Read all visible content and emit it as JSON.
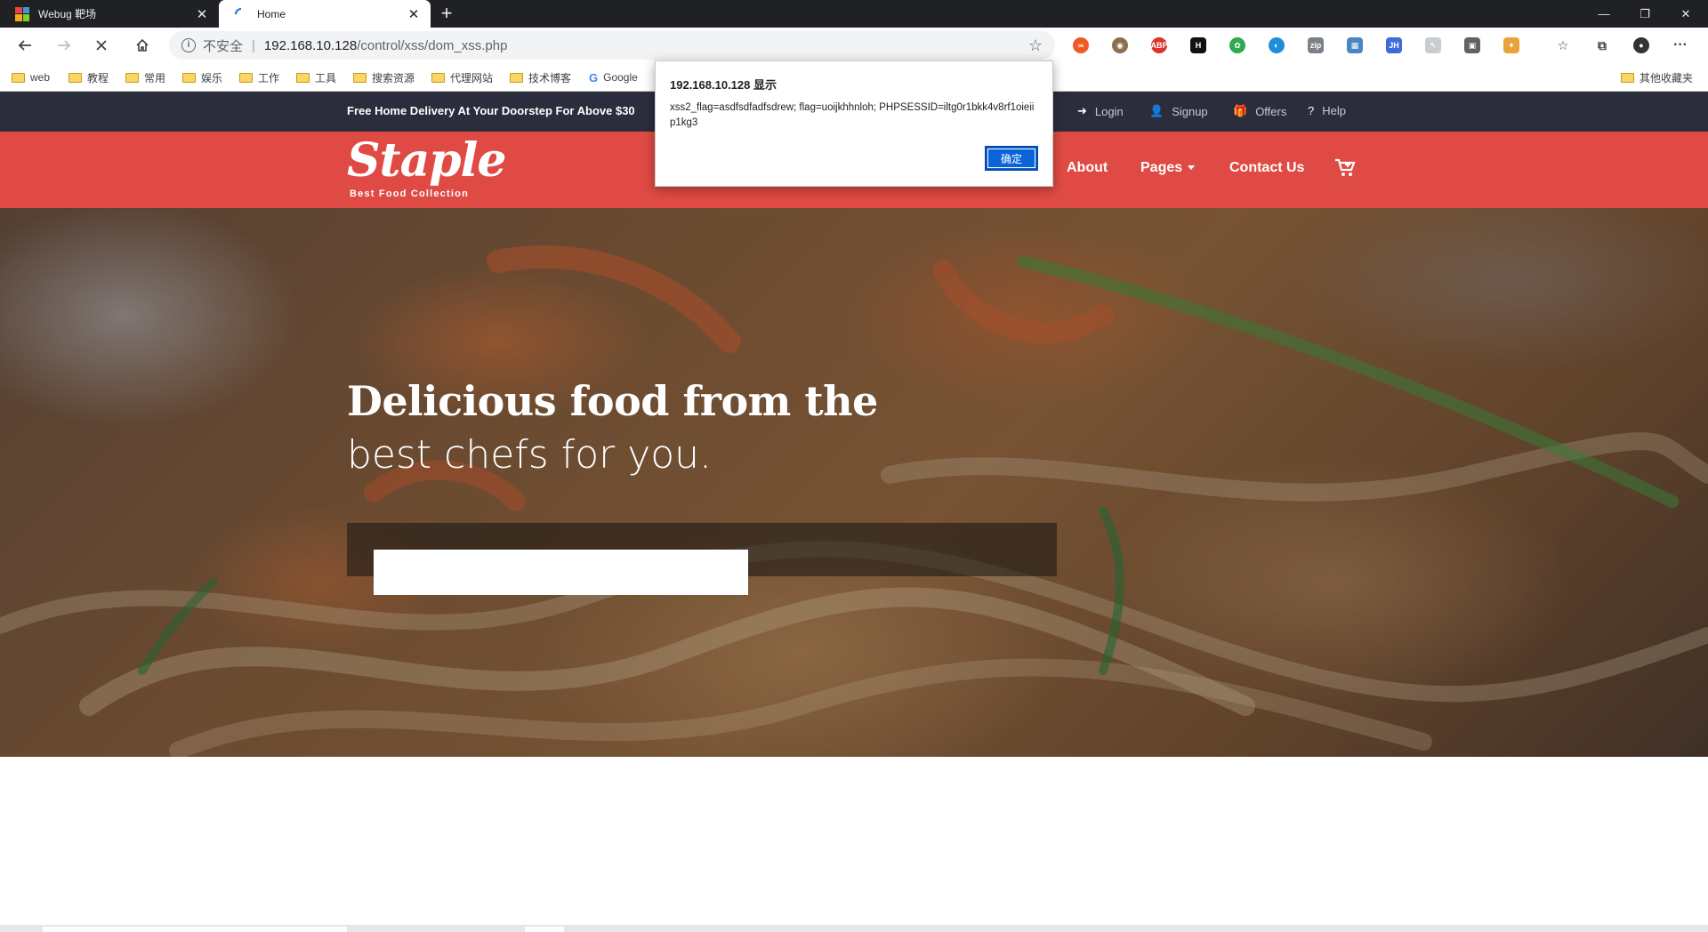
{
  "browser": {
    "tabs": [
      {
        "title": "Webug 靶场",
        "active": false
      },
      {
        "title": "Home",
        "active": true
      }
    ],
    "new_tab_symbol": "+",
    "security_label": "不安全",
    "url_host": "192.168.10.128",
    "url_path": "/control/xss/dom_xss.php",
    "bookmarks": [
      "web",
      "教程",
      "常用",
      "娱乐",
      "工作",
      "工具",
      "搜索资源",
      "代理网站",
      "技术博客",
      "Google"
    ],
    "other_bookmarks": "其他收藏夹",
    "icons": {
      "back": "back-arrow-icon",
      "forward": "forward-arrow-icon",
      "stop": "stop-x-icon",
      "home": "home-icon",
      "star": "star-icon",
      "menu": "more-dots-icon"
    }
  },
  "site": {
    "promo": "Free Home Delivery At Your Doorstep For Above $30",
    "top_links": [
      "Login",
      "Signup",
      "Offers",
      "Help"
    ],
    "logo": "Staple",
    "tagline": "Best Food Collection",
    "nav": [
      "About",
      "Pages",
      "Contact Us"
    ],
    "hero_title": "Delicious food from the",
    "hero_subtitle": "best chefs for you.",
    "search_value": ""
  },
  "dialog": {
    "title": "192.168.10.128 显示",
    "message": "xss2_flag=asdfsdfadfsdrew; flag=uoijkhhnloh; PHPSESSID=iltg0r1bkk4v8rf1oieiip1kg3",
    "ok_label": "确定"
  },
  "colors": {
    "header_red": "#e04a44",
    "topbar_navy": "#2b2c3c",
    "dialog_button": "#0a64d8"
  }
}
